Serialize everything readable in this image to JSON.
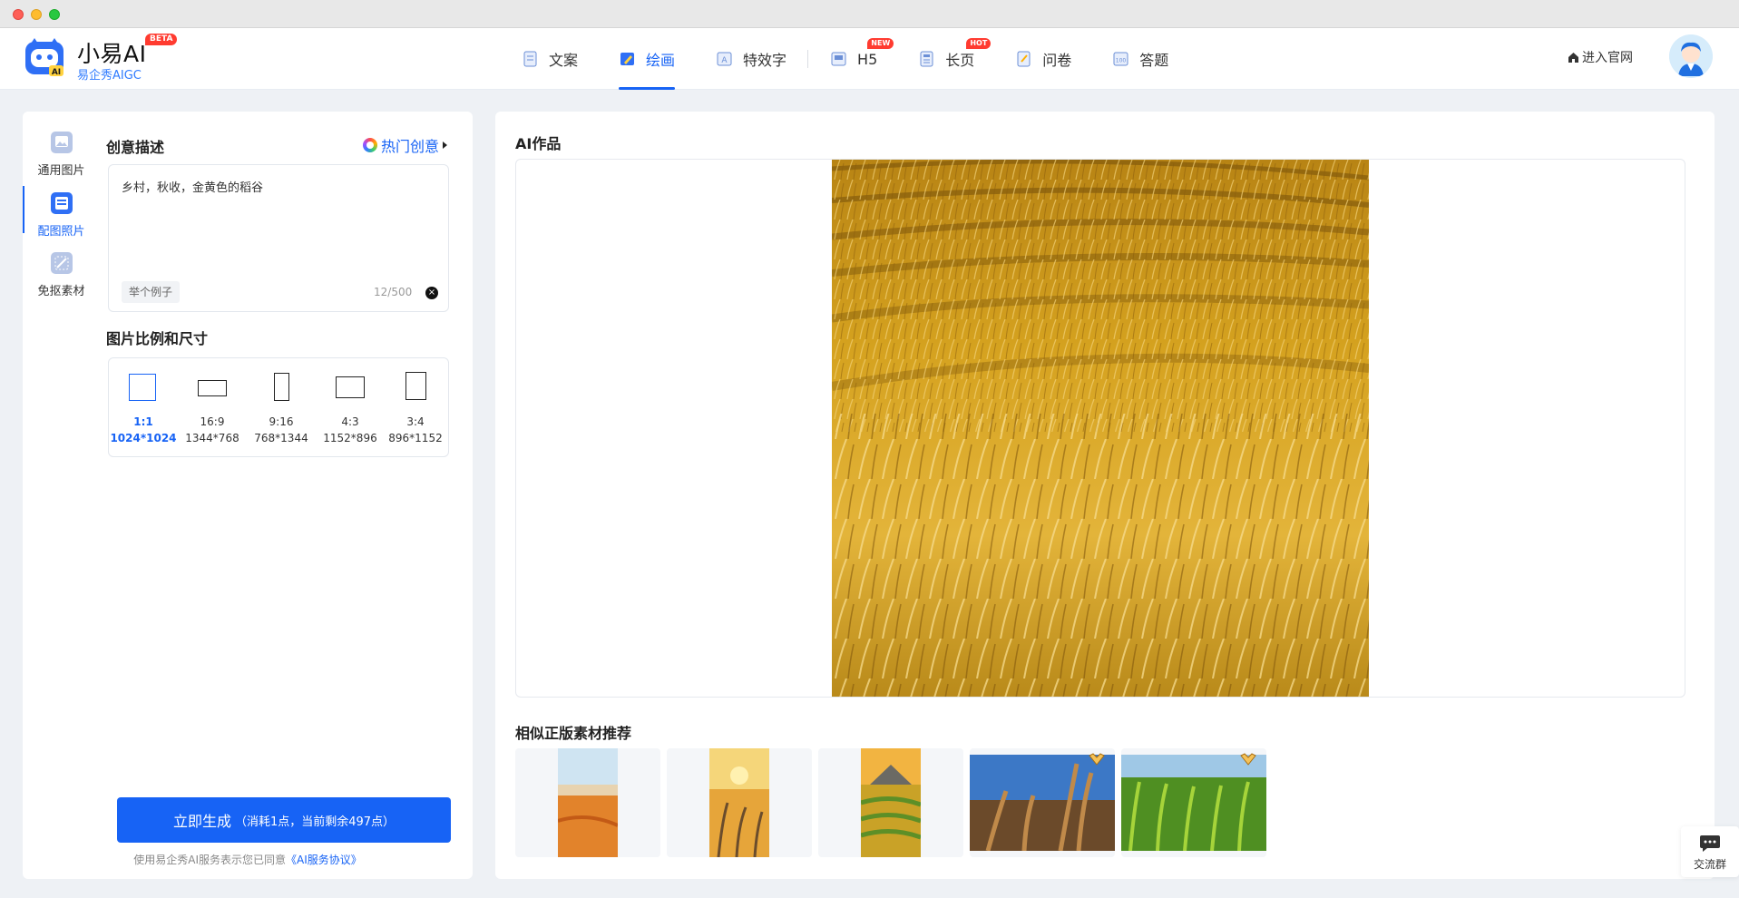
{
  "app": {
    "name": "小易AI",
    "beta_badge": "BETA",
    "subtitle": "易企秀AIGC"
  },
  "nav": {
    "items": [
      {
        "label": "文案",
        "icon": "document-icon"
      },
      {
        "label": "绘画",
        "icon": "paint-icon",
        "active": true
      },
      {
        "label": "特效字",
        "icon": "text-effect-icon"
      },
      {
        "label": "H5",
        "icon": "h5-icon",
        "badge": "NEW"
      },
      {
        "label": "长页",
        "icon": "long-page-icon",
        "badge": "HOT"
      },
      {
        "label": "问卷",
        "icon": "survey-icon"
      },
      {
        "label": "答题",
        "icon": "quiz-icon"
      }
    ],
    "home_link": "进入官网"
  },
  "sidebar": {
    "tabs": [
      {
        "label": "通用图片",
        "icon": "image-icon"
      },
      {
        "label": "配图照片",
        "icon": "photo-icon",
        "active": true
      },
      {
        "label": "免抠素材",
        "icon": "cutout-icon"
      }
    ]
  },
  "prompt": {
    "title": "创意描述",
    "hot_ideas": "热门创意",
    "value": "乡村，秋收，金黄色的稻谷",
    "example_chip": "举个例子",
    "char_count": "12/500"
  },
  "ratio": {
    "title": "图片比例和尺寸",
    "options": [
      {
        "label": "1:1",
        "size": "1024*1024",
        "active": true
      },
      {
        "label": "16:9",
        "size": "1344*768"
      },
      {
        "label": "9:16",
        "size": "768*1344"
      },
      {
        "label": "4:3",
        "size": "1152*896"
      },
      {
        "label": "3:4",
        "size": "896*1152"
      }
    ]
  },
  "generate": {
    "label": "立即生成",
    "note": "（消耗1点，当前剩余497点）",
    "agreement_prefix": "使用易企秀AI服务表示您已同意",
    "agreement_link": "《AI服务协议》"
  },
  "result": {
    "title": "AI作品",
    "recommend_title": "相似正版素材推荐"
  },
  "float": {
    "group_label": "交流群"
  },
  "colors": {
    "accent": "#1763f5",
    "badge": "#ff3b30",
    "wheat": "#c8960f"
  }
}
